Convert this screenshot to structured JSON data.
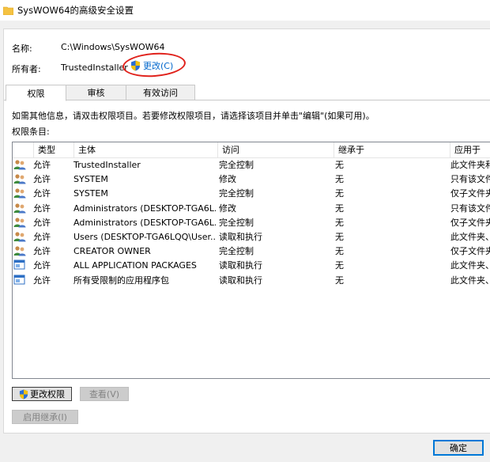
{
  "window": {
    "title": "SysWOW64的高级安全设置"
  },
  "name_row": {
    "label": "名称:",
    "value": "C:\\Windows\\SysWOW64"
  },
  "owner_row": {
    "label": "所有者:",
    "value": "TrustedInstaller",
    "change_link": "更改(C)"
  },
  "tabs": [
    {
      "label": "权限"
    },
    {
      "label": "审核"
    },
    {
      "label": "有效访问"
    }
  ],
  "info_text": "如需其他信息，请双击权限项目。若要修改权限项目，请选择该项目并单击\"编辑\"(如果可用)。",
  "entries_label": "权限条目:",
  "columns": [
    "类型",
    "主体",
    "访问",
    "继承于",
    "应用于"
  ],
  "rows": [
    {
      "icon": "users-icon",
      "type": "允许",
      "principal": "TrustedInstaller",
      "access": "完全控制",
      "inherited": "无",
      "applies": "此文件夹和"
    },
    {
      "icon": "users-icon",
      "type": "允许",
      "principal": "SYSTEM",
      "access": "修改",
      "inherited": "无",
      "applies": "只有该文件"
    },
    {
      "icon": "users-icon",
      "type": "允许",
      "principal": "SYSTEM",
      "access": "完全控制",
      "inherited": "无",
      "applies": "仅子文件夹"
    },
    {
      "icon": "users-icon",
      "type": "允许",
      "principal": "Administrators (DESKTOP-TGA6L...",
      "access": "修改",
      "inherited": "无",
      "applies": "只有该文件"
    },
    {
      "icon": "users-icon",
      "type": "允许",
      "principal": "Administrators (DESKTOP-TGA6L...",
      "access": "完全控制",
      "inherited": "无",
      "applies": "仅子文件夹"
    },
    {
      "icon": "users-icon",
      "type": "允许",
      "principal": "Users (DESKTOP-TGA6LQQ\\User...",
      "access": "读取和执行",
      "inherited": "无",
      "applies": "此文件夹、"
    },
    {
      "icon": "users-icon",
      "type": "允许",
      "principal": "CREATOR OWNER",
      "access": "完全控制",
      "inherited": "无",
      "applies": "仅子文件夹"
    },
    {
      "icon": "package-icon",
      "type": "允许",
      "principal": "ALL APPLICATION PACKAGES",
      "access": "读取和执行",
      "inherited": "无",
      "applies": "此文件夹、"
    },
    {
      "icon": "package-icon",
      "type": "允许",
      "principal": "所有受限制的应用程序包",
      "access": "读取和执行",
      "inherited": "无",
      "applies": "此文件夹、"
    }
  ],
  "buttons": {
    "change_permissions": "更改权限",
    "view": "查看(V)",
    "enable_inheritance": "启用继承(I)",
    "ok": "确定"
  },
  "colors": {
    "link": "#0066cc",
    "annotation_circle": "#e0211b",
    "focus": "#0078d7"
  }
}
